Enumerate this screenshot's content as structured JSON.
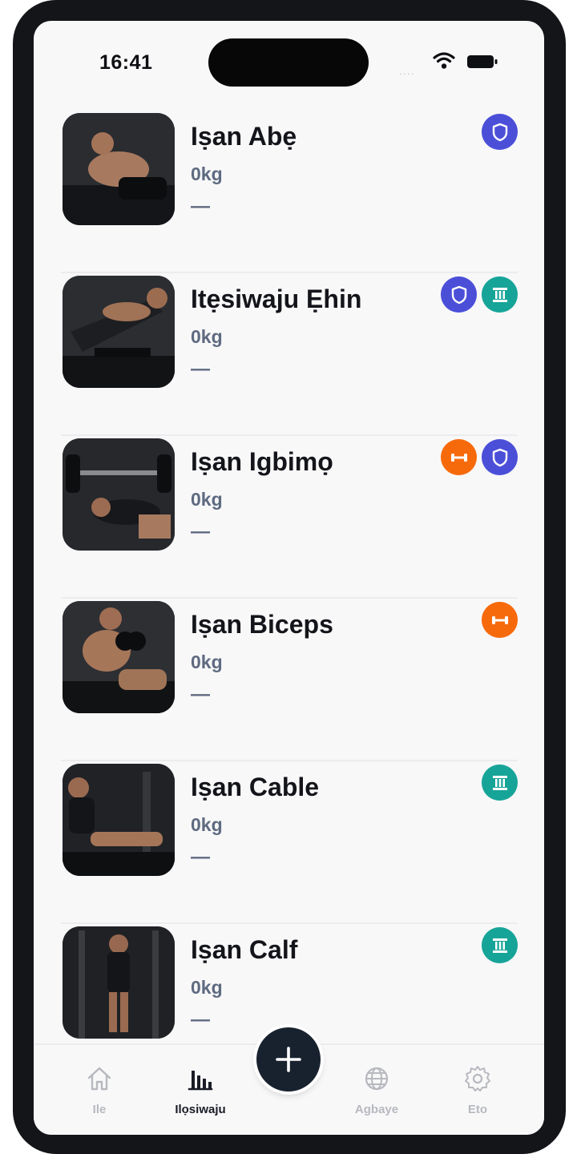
{
  "status_bar": {
    "time": "16:41",
    "signal": "....",
    "icons": [
      "wifi-icon",
      "battery-icon"
    ]
  },
  "exercises": [
    {
      "name": "Iṣan Abẹ",
      "weight": "0kg",
      "note": "—",
      "badges": [
        "shield"
      ]
    },
    {
      "name": "Itẹsiwaju Ẹhin",
      "weight": "0kg",
      "note": "—",
      "badges": [
        "shield",
        "column"
      ]
    },
    {
      "name": "Iṣan Igbimọ",
      "weight": "0kg",
      "note": "—",
      "badges": [
        "dumbbell",
        "shield"
      ]
    },
    {
      "name": "Iṣan Biceps",
      "weight": "0kg",
      "note": "—",
      "badges": [
        "dumbbell"
      ]
    },
    {
      "name": "Iṣan Cable",
      "weight": "0kg",
      "note": "—",
      "badges": [
        "column"
      ]
    },
    {
      "name": "Iṣan Calf",
      "weight": "0kg",
      "note": "—",
      "badges": [
        "column"
      ]
    }
  ],
  "tabbar": {
    "tabs": [
      {
        "label": "Ile",
        "icon": "home-icon",
        "active": false
      },
      {
        "label": "Ilọsiwaju",
        "icon": "bar-chart-icon",
        "active": true
      },
      {
        "label": "Agbaye",
        "icon": "globe-icon",
        "active": false
      },
      {
        "label": "Eto",
        "icon": "gear-icon",
        "active": false
      }
    ],
    "fab_icon": "plus-icon"
  },
  "colors": {
    "shield_badge": "#4b4fd8",
    "column_badge": "#17a498",
    "dumbbell_badge": "#f76a0c",
    "weight_text": "#5e6a80",
    "fab": "#18222f"
  }
}
